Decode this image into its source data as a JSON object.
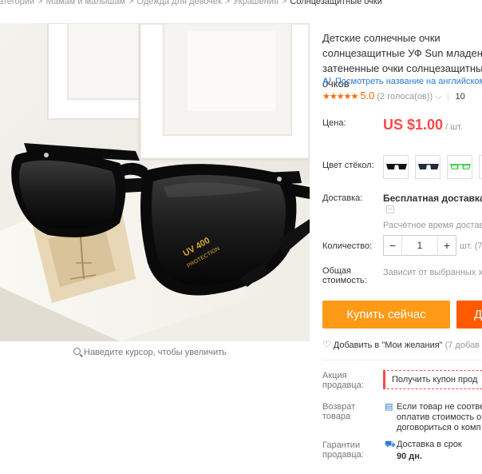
{
  "breadcrumb": {
    "items": [
      "атегории",
      "Мамам и малышам",
      "Одежда для девочек",
      "Украшения"
    ],
    "current": "Солнцезащитные очки",
    "separator": ">"
  },
  "image": {
    "lens_text_line1": "UV 400",
    "lens_text_line2": "PROTECTION",
    "zoom_hint": "Наведите курсор, чтобы увеличить"
  },
  "product": {
    "title": "Детские солнечные очки солнцезащитные УФ Sun младенца-затененные очки солнцезащитных очков",
    "translate_link": "Посмотреть название на английском",
    "rating_stars": "★★★★★",
    "rating_value": "5.0",
    "rating_count": "(2 голоса(ов))",
    "rating_caret": "⌵",
    "orders_count": "10"
  },
  "price": {
    "label": "Цена:",
    "amount": "US $1.00",
    "unit": "/ шт."
  },
  "color": {
    "label": "Цвет стёкол:",
    "swatches": [
      {
        "name": "black",
        "frame": "#111111",
        "lens": "#222222"
      },
      {
        "name": "navy",
        "frame": "#1c2a52",
        "lens": "#2b2b2b"
      },
      {
        "name": "green",
        "frame": "#3fd24a",
        "lens": "#e8e8e8"
      },
      {
        "name": "pink",
        "frame": "#e05aa0",
        "lens": "#333333"
      }
    ]
  },
  "shipping": {
    "label": "Доставка:",
    "main": "Бесплатная доставка в",
    "dropdown": "⌵",
    "sub": "Расчётное время доставки"
  },
  "quantity": {
    "label": "Количество:",
    "minus": "−",
    "value": "1",
    "plus": "+",
    "unit": "шт. (7"
  },
  "total": {
    "label_line1": "Общая",
    "label_line2": "стоимость:",
    "note": "Зависит от выбранных х"
  },
  "actions": {
    "buy_now": "Купить сейчас",
    "add_to_cart": "Д",
    "wishlist": "Добавить в \"Мои желания\"",
    "wishlist_count": "(7 добав"
  },
  "seller_promo": {
    "label_line1": "Акция",
    "label_line2": "продавца:",
    "coupon": "Получить купон прод"
  },
  "returns": {
    "label_line1": "Возврат",
    "label_line2": "товара",
    "lines": [
      "Если товар не соотве",
      "оплатив стоимость о",
      "договориться о комп"
    ]
  },
  "guarantee": {
    "label_line1": "Гарантии",
    "label_line2": "продавца:",
    "line1": "Доставка в срок",
    "line2": "90 дн."
  },
  "colors": {
    "accent": "#ff4747",
    "buy_now_bg": "#ff9a16",
    "cart_bg": "#ff5a00",
    "link": "#2a7ad6",
    "star": "#ff6a00"
  }
}
